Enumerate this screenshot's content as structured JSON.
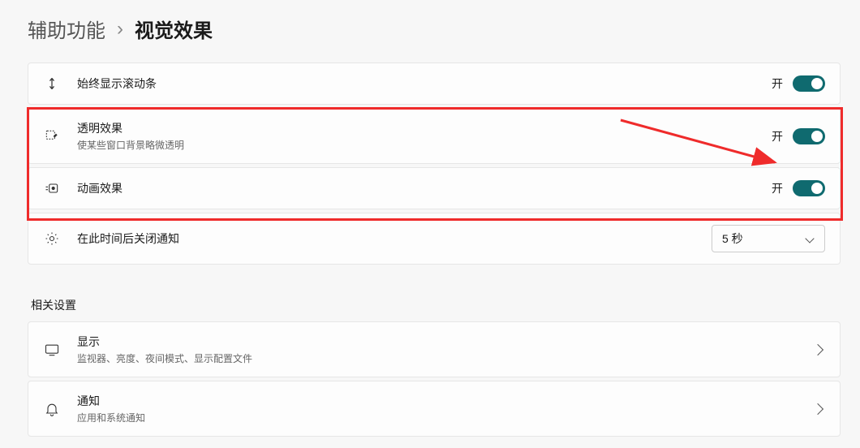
{
  "breadcrumb": {
    "parent": "辅助功能",
    "current": "视觉效果"
  },
  "items": {
    "scrollbar": {
      "title": "始终显示滚动条",
      "state": "开"
    },
    "transparency": {
      "title": "透明效果",
      "sub": "使某些窗口背景略微透明",
      "state": "开"
    },
    "animation": {
      "title": "动画效果",
      "state": "开"
    },
    "dismiss": {
      "title": "在此时间后关闭通知",
      "selected": "5 秒"
    }
  },
  "related": {
    "heading": "相关设置",
    "display": {
      "title": "显示",
      "sub": "监视器、亮度、夜间模式、显示配置文件"
    },
    "notifications": {
      "title": "通知",
      "sub": "应用和系统通知"
    }
  }
}
